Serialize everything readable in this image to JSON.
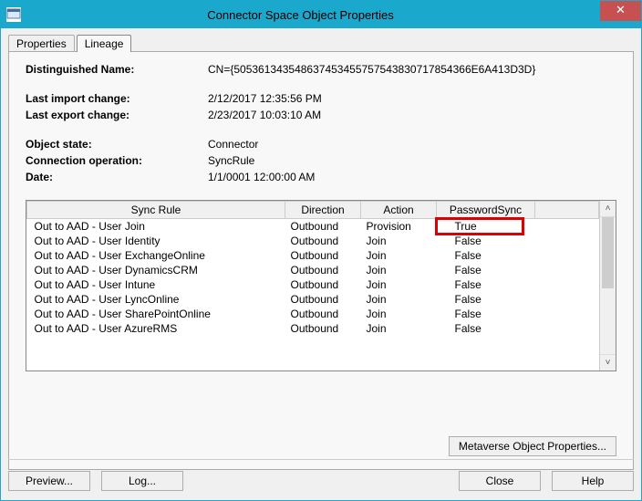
{
  "window": {
    "title": "Connector Space Object Properties"
  },
  "tabs": {
    "properties": "Properties",
    "lineage": "Lineage"
  },
  "info": {
    "dn_label": "Distinguished Name:",
    "dn_value": "CN={5053613435486374534557575438307178543​66E6A413D3D}",
    "last_import_label": "Last import change:",
    "last_import_value": "2/12/2017 12:35:56 PM",
    "last_export_label": "Last export change:",
    "last_export_value": "2/23/2017 10:03:10 AM",
    "object_state_label": "Object state:",
    "object_state_value": "Connector",
    "conn_op_label": "Connection operation:",
    "conn_op_value": "SyncRule",
    "date_label": "Date:",
    "date_value": "1/1/0001 12:00:00 AM"
  },
  "table": {
    "headers": {
      "rule": "Sync Rule",
      "direction": "Direction",
      "action": "Action",
      "pwdsync": "PasswordSync"
    },
    "rows": [
      {
        "rule": "Out to AAD - User Join",
        "direction": "Outbound",
        "action": "Provision",
        "pwdsync": "True",
        "highlight": true
      },
      {
        "rule": "Out to AAD - User Identity",
        "direction": "Outbound",
        "action": "Join",
        "pwdsync": "False"
      },
      {
        "rule": "Out to AAD - User ExchangeOnline",
        "direction": "Outbound",
        "action": "Join",
        "pwdsync": "False"
      },
      {
        "rule": "Out to AAD - User DynamicsCRM",
        "direction": "Outbound",
        "action": "Join",
        "pwdsync": "False"
      },
      {
        "rule": "Out to AAD - User Intune",
        "direction": "Outbound",
        "action": "Join",
        "pwdsync": "False"
      },
      {
        "rule": "Out to AAD - User LyncOnline",
        "direction": "Outbound",
        "action": "Join",
        "pwdsync": "False"
      },
      {
        "rule": "Out to AAD - User SharePointOnline",
        "direction": "Outbound",
        "action": "Join",
        "pwdsync": "False"
      },
      {
        "rule": "Out to AAD - User AzureRMS",
        "direction": "Outbound",
        "action": "Join",
        "pwdsync": "False"
      }
    ]
  },
  "buttons": {
    "metaverse": "Metaverse Object Properties...",
    "preview": "Preview...",
    "log": "Log...",
    "close": "Close",
    "help": "Help"
  }
}
